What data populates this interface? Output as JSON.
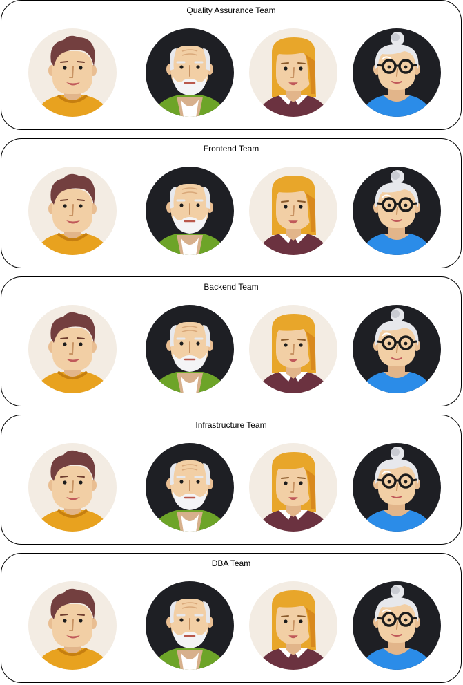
{
  "teams": [
    {
      "title": "Quality Assurance Team"
    },
    {
      "title": "Frontend Team"
    },
    {
      "title": "Backend Team"
    },
    {
      "title": "Infrastructure Team"
    },
    {
      "title": "DBA Team"
    }
  ],
  "avatar_icons": [
    "young-man-avatar-icon",
    "old-man-avatar-icon",
    "blonde-woman-avatar-icon",
    "grandmother-avatar-icon"
  ],
  "colors": {
    "light_bg": "#F3ECE3",
    "dark_bg": "#1E1F24",
    "skin": "#F2CFA5",
    "hair_brown": "#733F3F",
    "shirt_orange": "#E8A21F",
    "shirt_green": "#6DA428",
    "hair_blonde": "#E8A62A",
    "shirt_maroon": "#6B3240",
    "shirt_blue": "#2B8CE8",
    "hair_white": "#E7E8EC"
  }
}
